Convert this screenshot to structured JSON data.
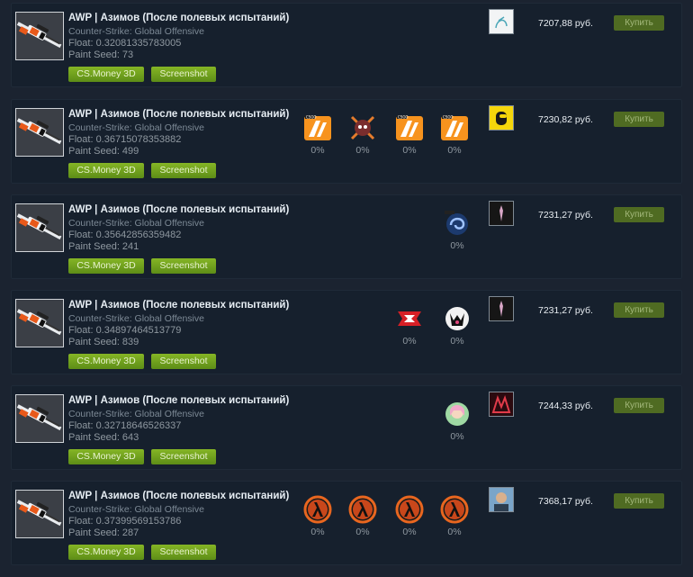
{
  "listings": [
    {
      "title": "AWP | Азимов (После полевых испытаний)",
      "game": "Counter-Strike: Global Offensive",
      "float": "Float: 0.32081335783005",
      "seed": "Paint Seed: 73",
      "btn3d": "CS.Money 3D",
      "btnShot": "Screenshot",
      "price": "7207,88 руб.",
      "buy": "Купить",
      "avatar": "white-sketch-avatar",
      "stickers": []
    },
    {
      "title": "AWP | Азимов (После полевых испытаний)",
      "game": "Counter-Strike: Global Offensive",
      "float": "Float: 0.36715078353882",
      "seed": "Paint Seed: 499",
      "btn3d": "CS.Money 3D",
      "btnShot": "Screenshot",
      "price": "7230,82 руб.",
      "buy": "Купить",
      "avatar": "yellow-among-us-avatar",
      "stickers": [
        {
          "name": "fnatic-sticker",
          "pct": "0%"
        },
        {
          "name": "skull-crossed-sticker",
          "pct": "0%"
        },
        {
          "name": "fnatic-sticker",
          "pct": "0%"
        },
        {
          "name": "fnatic-sticker",
          "pct": "0%"
        }
      ]
    },
    {
      "title": "AWP | Азимов (После полевых испытаний)",
      "game": "Counter-Strike: Global Offensive",
      "float": "Float: 0.35642856359482",
      "seed": "Paint Seed: 241",
      "btn3d": "CS.Money 3D",
      "btnShot": "Screenshot",
      "price": "7231,27 руб.",
      "buy": "Купить",
      "avatar": "dark-figure-avatar",
      "stickers": [
        {
          "name": "blue-swirl-sticker",
          "pct": "0%"
        }
      ]
    },
    {
      "title": "AWP | Азимов (После полевых испытаний)",
      "game": "Counter-Strike: Global Offensive",
      "float": "Float: 0.34897464513779",
      "seed": "Paint Seed: 839",
      "btn3d": "CS.Money 3D",
      "btnShot": "Screenshot",
      "price": "7231,27 руб.",
      "buy": "Купить",
      "avatar": "dark-figure-avatar",
      "stickers": [
        {
          "name": "faze-sticker",
          "pct": "0%"
        },
        {
          "name": "g2-sticker",
          "pct": "0%"
        }
      ]
    },
    {
      "title": "AWP | Азимов (После полевых испытаний)",
      "game": "Counter-Strike: Global Offensive",
      "float": "Float: 0.32718646526337",
      "seed": "Paint Seed: 643",
      "btn3d": "CS.Money 3D",
      "btnShot": "Screenshot",
      "price": "7244,33 руб.",
      "buy": "Купить",
      "avatar": "red-triangle-avatar",
      "stickers": [
        {
          "name": "anime-girl-sticker",
          "pct": "0%"
        }
      ]
    },
    {
      "title": "AWP | Азимов (После полевых испытаний)",
      "game": "Counter-Strike: Global Offensive",
      "float": "Float: 0.37399569153786",
      "seed": "Paint Seed: 287",
      "btn3d": "CS.Money 3D",
      "btnShot": "Screenshot",
      "price": "7368,17 руб.",
      "buy": "Купить",
      "avatar": "man-photo-avatar",
      "stickers": [
        {
          "name": "half-life-lambda-sticker",
          "pct": "0%"
        },
        {
          "name": "half-life-lambda-sticker",
          "pct": "0%"
        },
        {
          "name": "half-life-lambda-sticker",
          "pct": "0%"
        },
        {
          "name": "half-life-lambda-sticker",
          "pct": "0%"
        }
      ]
    }
  ]
}
